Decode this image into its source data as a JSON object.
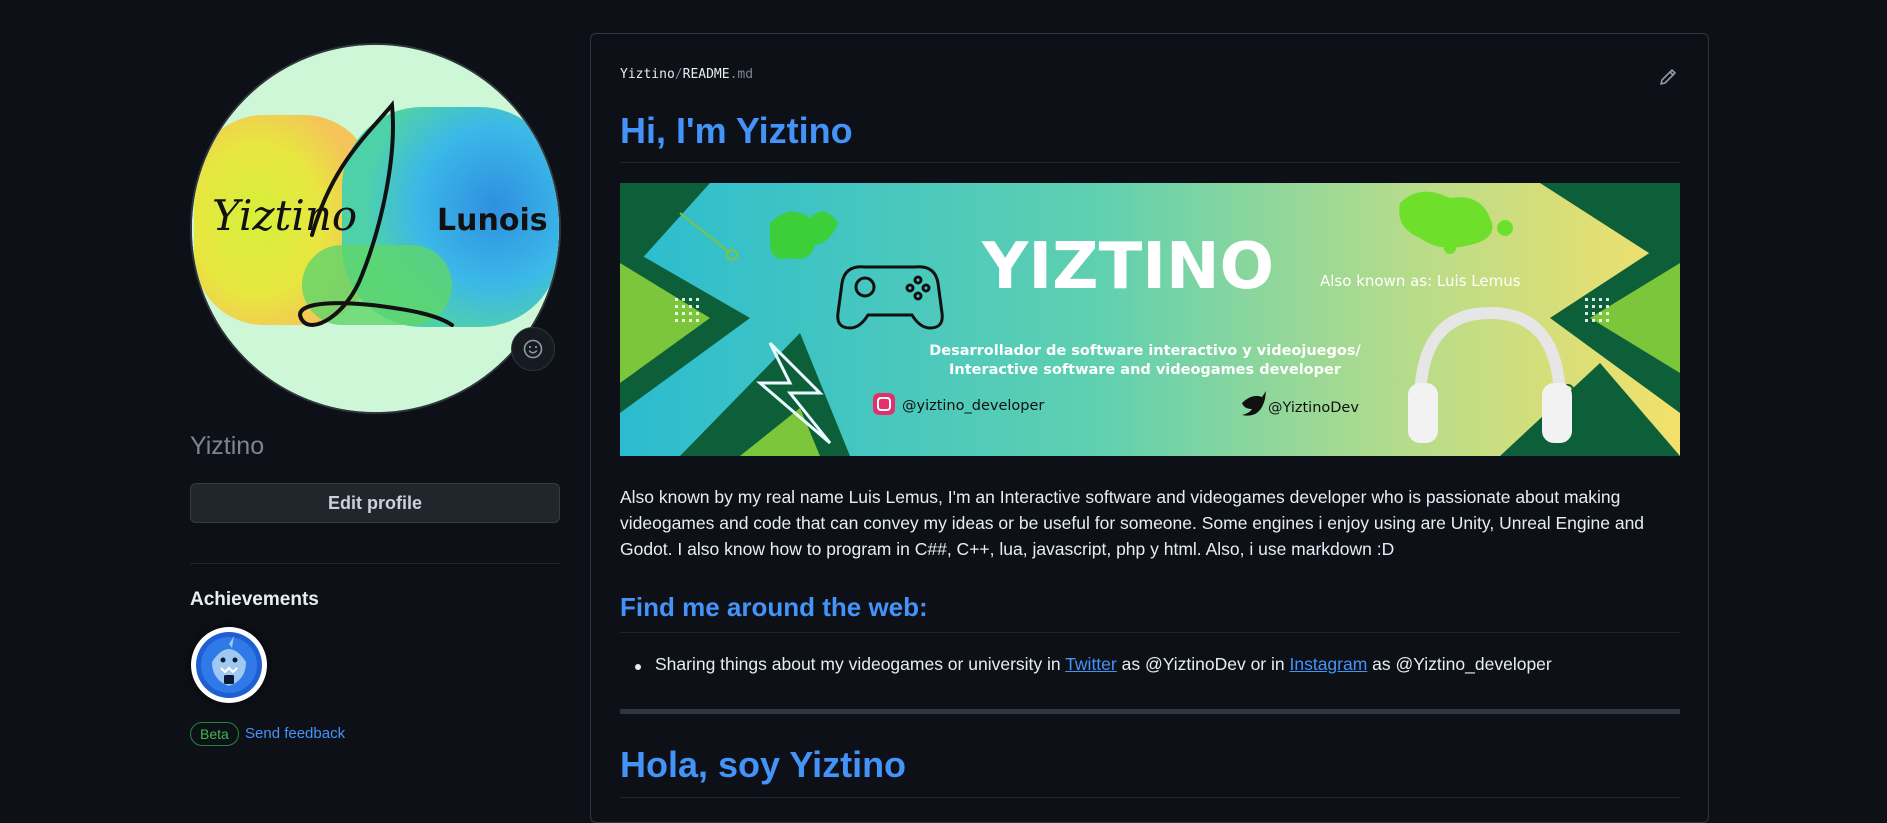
{
  "profile": {
    "username": "Yiztino",
    "edit_profile_label": "Edit profile",
    "avatar_text_left": "Yiztino",
    "avatar_text_right": "Lunois"
  },
  "achievements": {
    "title": "Achievements",
    "beta_label": "Beta",
    "feedback_label": "Send feedback"
  },
  "readme": {
    "path_owner": "Yiztino",
    "path_sep": "/",
    "path_file": "README",
    "path_ext": ".md",
    "heading_1": "Hi, I'm Yiztino",
    "banner": {
      "title": "YIZTINO",
      "aka": "Also known as: Luis Lemus",
      "line1": "Desarrollador de software interactivo y videojuegos/",
      "line2": "Interactive software and videogames developer",
      "instagram": "@yiztino_developer",
      "twitter": "@YiztinoDev"
    },
    "paragraph": "Also known by my real name Luis Lemus, I'm an Interactive software and videogames developer who is passionate about making videogames and code that can convey my ideas or be useful for someone. Some engines i enjoy using are Unity, Unreal Engine and Godot. I also know how to program in C##, C++, lua, javascript, php y html. Also, i use markdown :D",
    "heading_2": "Find me around the web:",
    "list_item": {
      "prefix": "Sharing things about my videogames or university in ",
      "link1": "Twitter",
      "middle": " as @YiztinoDev or in ",
      "link2": "Instagram",
      "suffix": " as @Yiztino_developer"
    },
    "heading_3": "Hola, soy Yiztino"
  },
  "colors": {
    "background": "#0d1117",
    "link": "#4493f8",
    "text": "#e6edf3",
    "muted": "#7d8590"
  }
}
